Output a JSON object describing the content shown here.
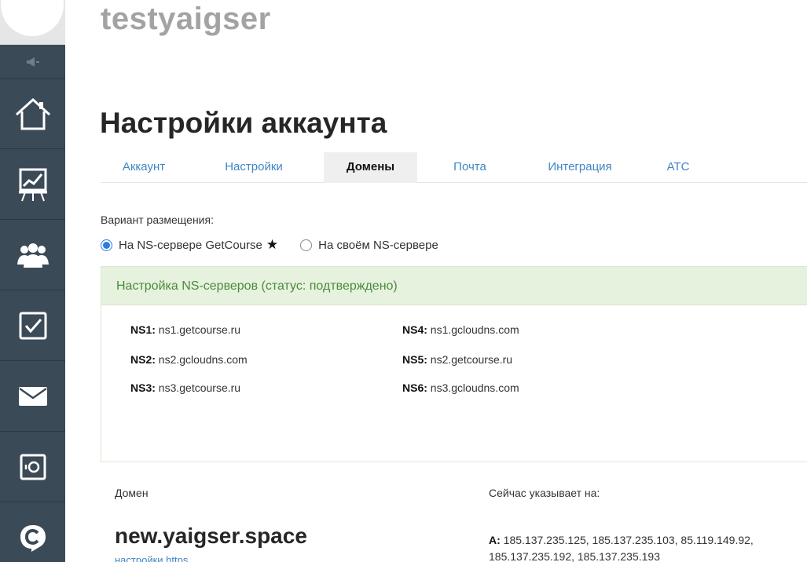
{
  "sidebar": {
    "items": [
      {
        "name": "home",
        "icon": "home-icon"
      },
      {
        "name": "statistics",
        "icon": "chart-board-icon"
      },
      {
        "name": "users",
        "icon": "users-group-icon"
      },
      {
        "name": "tasks",
        "icon": "checkbox-icon"
      },
      {
        "name": "messages",
        "icon": "envelope-icon"
      },
      {
        "name": "safe",
        "icon": "safe-icon"
      },
      {
        "name": "getcourse",
        "icon": "getcourse-logo-icon"
      }
    ],
    "colors": {
      "background": "#3b4a57",
      "divider": "#2c3944",
      "icon": "#ffffff"
    }
  },
  "site": {
    "title": "testyaigser"
  },
  "page": {
    "title": "Настройки аккаунта"
  },
  "tabs": [
    {
      "label": "Аккаунт",
      "active": false
    },
    {
      "label": "Настройки",
      "active": false
    },
    {
      "label": "Домены",
      "active": true
    },
    {
      "label": "Почта",
      "active": false
    },
    {
      "label": "Интеграция",
      "active": false
    },
    {
      "label": "АТС",
      "active": false
    }
  ],
  "placement": {
    "label": "Вариант размещения:",
    "options": [
      {
        "label": "На NS-сервере GetCourse",
        "checked": true,
        "star": "★"
      },
      {
        "label": "На своём NS-сервере",
        "checked": false
      }
    ]
  },
  "ns_panel": {
    "header": "Настройка NS-серверов (статус: подтверждено)",
    "servers": [
      {
        "key": "NS1:",
        "value": "ns1.getcourse.ru"
      },
      {
        "key": "NS2:",
        "value": "ns2.gcloudns.com"
      },
      {
        "key": "NS3:",
        "value": "ns3.getcourse.ru"
      },
      {
        "key": "NS4:",
        "value": "ns1.gcloudns.com"
      },
      {
        "key": "NS5:",
        "value": "ns2.getcourse.ru"
      },
      {
        "key": "NS6:",
        "value": "ns3.gcloudns.com"
      }
    ],
    "colors": {
      "header_bg": "#e6f2dd",
      "header_text": "#4a8a3c"
    }
  },
  "domain": {
    "label": "Домен",
    "points_label": "Сейчас указывает на:",
    "name": "new.yaigser.space",
    "link": "настройки https",
    "records_key": "A:",
    "records_value": "185.137.235.125, 185.137.235.103, 85.119.149.92, 185.137.235.192, 185.137.235.193"
  },
  "colors": {
    "accent": "#3f86c4",
    "radio": "#2a7be4",
    "title_gray": "#a3a3a3"
  }
}
